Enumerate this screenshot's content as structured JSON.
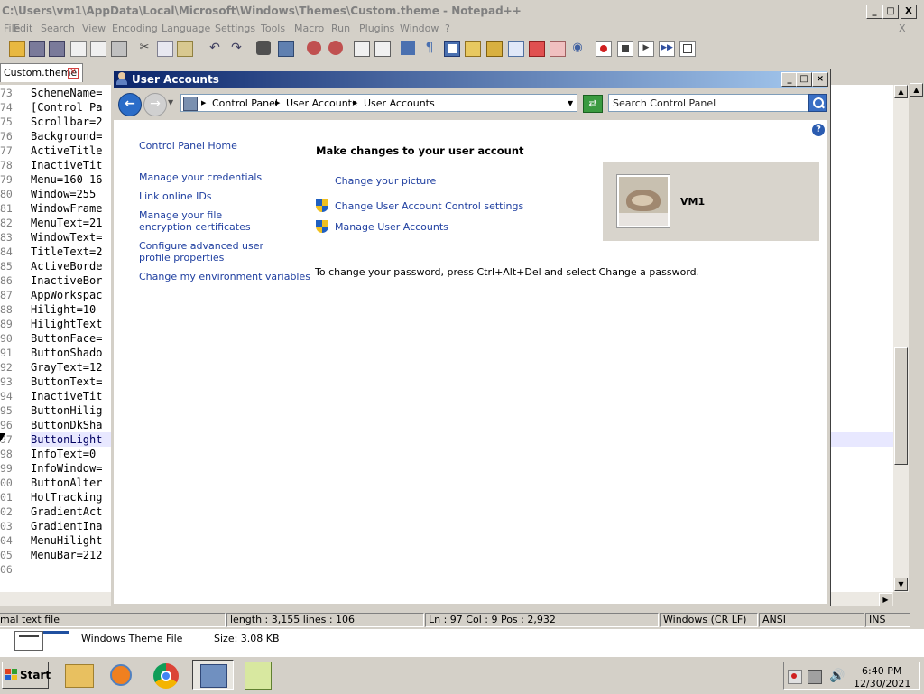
{
  "npp": {
    "title": "C:\\Users\\vm1\\AppData\\Local\\Microsoft\\Windows\\Themes\\Custom.theme - Notepad++",
    "caption_minimize": "_",
    "caption_maximize": "□",
    "caption_close": "X",
    "close_document": "X",
    "menu": [
      "File",
      "Edit",
      "Search",
      "View",
      "Encoding",
      "Language",
      "Settings",
      "Tools",
      "Macro",
      "Run",
      "Plugins",
      "Window",
      "?"
    ],
    "tab_label": "Custom.theme",
    "lines": [
      {
        "num": "73",
        "text": "SchemeName="
      },
      {
        "num": "74",
        "text": "[Control Pa"
      },
      {
        "num": "75",
        "text": "Scrollbar=2"
      },
      {
        "num": "76",
        "text": "Background="
      },
      {
        "num": "77",
        "text": "ActiveTitle"
      },
      {
        "num": "78",
        "text": "InactiveTit"
      },
      {
        "num": "79",
        "text": "Menu=160 16"
      },
      {
        "num": "80",
        "text": "Window=255"
      },
      {
        "num": "81",
        "text": "WindowFrame"
      },
      {
        "num": "82",
        "text": "MenuText=21"
      },
      {
        "num": "83",
        "text": "WindowText="
      },
      {
        "num": "84",
        "text": "TitleText=2"
      },
      {
        "num": "85",
        "text": "ActiveBorde"
      },
      {
        "num": "86",
        "text": "InactiveBor"
      },
      {
        "num": "87",
        "text": "AppWorkspac"
      },
      {
        "num": "88",
        "text": "Hilight=10"
      },
      {
        "num": "89",
        "text": "HilightText"
      },
      {
        "num": "90",
        "text": "ButtonFace="
      },
      {
        "num": "91",
        "text": "ButtonShado"
      },
      {
        "num": "92",
        "text": "GrayText=12"
      },
      {
        "num": "93",
        "text": "ButtonText="
      },
      {
        "num": "94",
        "text": "InactiveTit"
      },
      {
        "num": "95",
        "text": "ButtonHilig"
      },
      {
        "num": "96",
        "text": "ButtonDkSha"
      },
      {
        "num": "97",
        "text": "ButtonLight"
      },
      {
        "num": "98",
        "text": "InfoText=0"
      },
      {
        "num": "99",
        "text": "InfoWindow="
      },
      {
        "num": "00",
        "text": "ButtonAlter"
      },
      {
        "num": "01",
        "text": "HotTracking"
      },
      {
        "num": "02",
        "text": "GradientAct"
      },
      {
        "num": "03",
        "text": "GradientIna"
      },
      {
        "num": "04",
        "text": "MenuHilight"
      },
      {
        "num": "05",
        "text": "MenuBar=212"
      },
      {
        "num": "06",
        "text": ""
      }
    ],
    "status": {
      "type": "mal text file",
      "length": "length : 3,155    lines : 106",
      "position": "Ln : 97    Col : 9    Pos : 2,932",
      "eol": "Windows (CR LF)",
      "encoding": "ANSI",
      "mode": "INS"
    }
  },
  "explorer_detail": {
    "file_type": "Windows Theme File",
    "size": "Size:  3.08 KB"
  },
  "user_accounts": {
    "title": "User Accounts",
    "breadcrumbs": [
      "Control Panel",
      "User Accounts",
      "User Accounts"
    ],
    "search_placeholder": "Search Control Panel",
    "help_label": "?",
    "sidebar": {
      "home": "Control Panel Home",
      "links": [
        "Manage your credentials",
        "Link online IDs",
        "Manage your file encryption certificates",
        "Configure advanced user profile properties",
        "Change my environment variables"
      ]
    },
    "main": {
      "heading": "Make changes to your user account",
      "change_picture": "Change your picture",
      "uac_settings": "Change User Account Control settings",
      "manage_accounts": "Manage User Accounts",
      "password_note": "To change your password, press Ctrl+Alt+Del and select Change a password."
    },
    "account": {
      "username": "VM1"
    }
  },
  "taskbar": {
    "start_label": "Start",
    "clock_time": "6:40 PM",
    "clock_date": "12/30/2021"
  }
}
